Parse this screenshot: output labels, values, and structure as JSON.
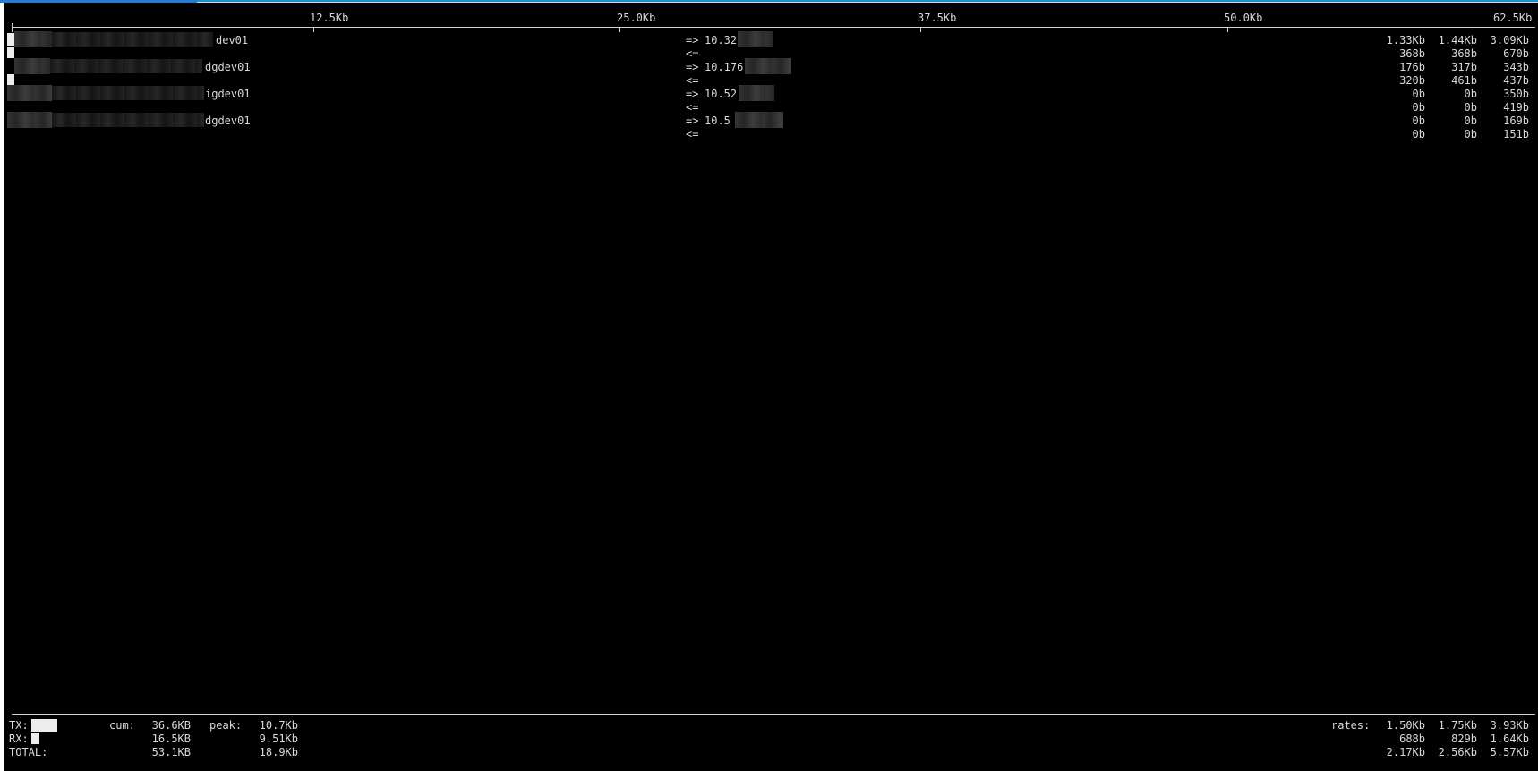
{
  "scale": {
    "labels": [
      "12.5Kb",
      "25.0Kb",
      "37.5Kb",
      "50.0Kb",
      "62.5Kb"
    ]
  },
  "connections": [
    {
      "local_host": "dev01",
      "direction_out": "=>",
      "direction_in": "<=",
      "remote_host": "10.32",
      "tx_rates": [
        "1.33Kb",
        "1.44Kb",
        "3.09Kb"
      ],
      "rx_rates": [
        "368b",
        "368b",
        "670b"
      ]
    },
    {
      "local_host": "dgdev01",
      "direction_out": "=>",
      "direction_in": "<=",
      "remote_host": "10.176",
      "tx_rates": [
        "176b",
        "317b",
        "343b"
      ],
      "rx_rates": [
        "320b",
        "461b",
        "437b"
      ]
    },
    {
      "local_host": "igdev01",
      "direction_out": "=>",
      "direction_in": "<=",
      "remote_host": "10.52",
      "tx_rates": [
        "0b",
        "0b",
        "350b"
      ],
      "rx_rates": [
        "0b",
        "0b",
        "419b"
      ]
    },
    {
      "local_host": "dgdev01",
      "direction_out": "=>",
      "direction_in": "<=",
      "remote_host": "10.5",
      "tx_rates": [
        "0b",
        "0b",
        "169b"
      ],
      "rx_rates": [
        "0b",
        "0b",
        "151b"
      ]
    }
  ],
  "totals": {
    "tx_label": "TX:",
    "rx_label": "RX:",
    "total_label": "TOTAL:",
    "cum_label": "cum:",
    "peak_label": "peak:",
    "rates_label": "rates:",
    "tx": {
      "cum": "36.6KB",
      "peak": "10.7Kb",
      "rates": [
        "1.50Kb",
        "1.75Kb",
        "3.93Kb"
      ]
    },
    "rx": {
      "cum": "16.5KB",
      "peak": "9.51Kb",
      "rates": [
        "688b",
        "829b",
        "1.64Kb"
      ]
    },
    "total": {
      "cum": "53.1KB",
      "peak": "18.9Kb",
      "rates": [
        "2.17Kb",
        "2.56Kb",
        "5.57Kb"
      ]
    }
  },
  "colors": {
    "background": "#000000",
    "text": "#d9d9d9",
    "title_accent": "#1e7fd8"
  }
}
